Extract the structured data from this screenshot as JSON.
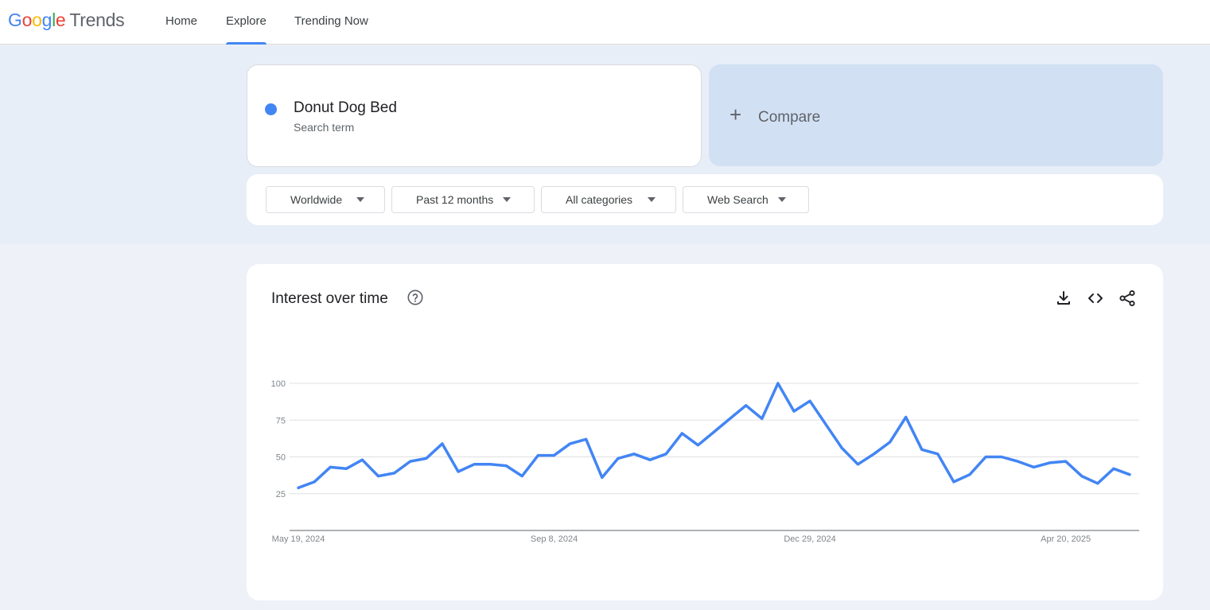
{
  "app": {
    "logo_google": "Google",
    "logo_trends": "Trends",
    "nav": [
      {
        "label": "Home",
        "active": false
      },
      {
        "label": "Explore",
        "active": true
      },
      {
        "label": "Trending Now",
        "active": false
      }
    ]
  },
  "search": {
    "term": "Donut Dog Bed",
    "term_type": "Search term",
    "term_color": "#4285f4",
    "compare_label": "Compare"
  },
  "filters": [
    {
      "label": "Worldwide"
    },
    {
      "label": "Past 12 months"
    },
    {
      "label": "All categories"
    },
    {
      "label": "Web Search"
    }
  ],
  "widget": {
    "title": "Interest over time",
    "icons": [
      "help-icon",
      "download-icon",
      "embed-icon",
      "share-icon"
    ]
  },
  "chart_data": {
    "type": "line",
    "title": "Interest over time",
    "x": [
      "May 19, 2024",
      "May 26, 2024",
      "Jun 2, 2024",
      "Jun 9, 2024",
      "Jun 16, 2024",
      "Jun 23, 2024",
      "Jun 30, 2024",
      "Jul 7, 2024",
      "Jul 14, 2024",
      "Jul 21, 2024",
      "Jul 28, 2024",
      "Aug 4, 2024",
      "Aug 11, 2024",
      "Aug 18, 2024",
      "Aug 25, 2024",
      "Sep 1, 2024",
      "Sep 8, 2024",
      "Sep 15, 2024",
      "Sep 22, 2024",
      "Sep 29, 2024",
      "Oct 6, 2024",
      "Oct 13, 2024",
      "Oct 20, 2024",
      "Oct 27, 2024",
      "Nov 3, 2024",
      "Nov 10, 2024",
      "Nov 17, 2024",
      "Nov 24, 2024",
      "Dec 1, 2024",
      "Dec 8, 2024",
      "Dec 15, 2024",
      "Dec 22, 2024",
      "Dec 29, 2024",
      "Jan 5, 2025",
      "Jan 12, 2025",
      "Jan 19, 2025",
      "Jan 26, 2025",
      "Feb 2, 2025",
      "Feb 9, 2025",
      "Feb 16, 2025",
      "Feb 23, 2025",
      "Mar 2, 2025",
      "Mar 9, 2025",
      "Mar 16, 2025",
      "Mar 23, 2025",
      "Mar 30, 2025",
      "Apr 6, 2025",
      "Apr 13, 2025",
      "Apr 20, 2025",
      "Apr 27, 2025",
      "May 4, 2025",
      "May 11, 2025"
    ],
    "series": [
      {
        "color": "#4285f4",
        "values": [
          29,
          33,
          43,
          42,
          48,
          37,
          39,
          47,
          49,
          59,
          40,
          45,
          45,
          44,
          37,
          51,
          51,
          59,
          62,
          36,
          49,
          52,
          48,
          52,
          66,
          58,
          67,
          76,
          85,
          76,
          100,
          81,
          88,
          72,
          56,
          45,
          52,
          60,
          77,
          55,
          52,
          33,
          38,
          50,
          50,
          47,
          43,
          46,
          47,
          37,
          32,
          42,
          38
        ]
      }
    ],
    "tick_labels_x": [
      "May 19, 2024",
      "Sep 8, 2024",
      "Dec 29, 2024",
      "Apr 20, 2025"
    ],
    "tick_labels_y": [
      "25",
      "50",
      "75",
      "100"
    ],
    "ylim": [
      0,
      100
    ],
    "grid": true,
    "legend": "none"
  }
}
